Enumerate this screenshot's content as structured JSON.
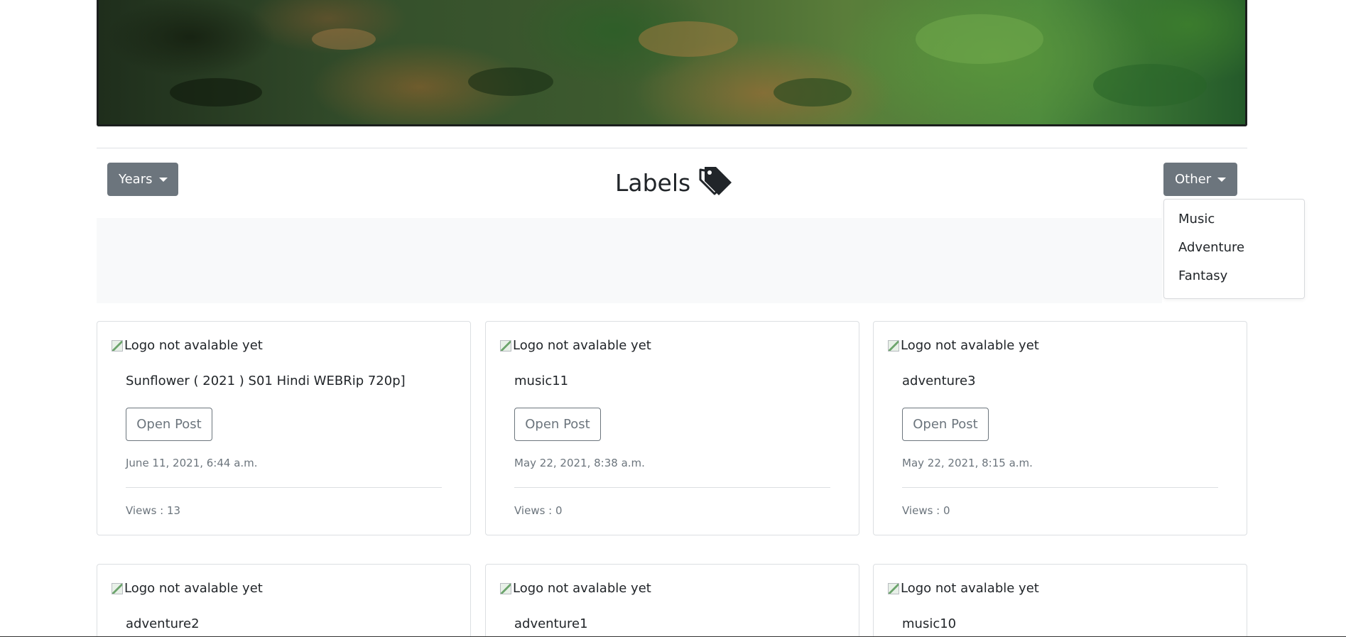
{
  "hero": {
    "image": "forest-banner"
  },
  "filters": {
    "years_label": "Years",
    "other_label": "Other",
    "other_menu": [
      "Music",
      "Adventure",
      "Fantasy"
    ]
  },
  "heading": {
    "title": "Labels",
    "icon": "tags-icon"
  },
  "posts": [
    {
      "image_alt": "Logo not avalable yet",
      "title": "Sunflower ( 2021 ) S01 Hindi WEBRip 720p]",
      "button": "Open Post",
      "date": "June 11, 2021, 6:44 a.m.",
      "views": "Views : 13"
    },
    {
      "image_alt": "Logo not avalable yet",
      "title": "music11",
      "button": "Open Post",
      "date": "May 22, 2021, 8:38 a.m.",
      "views": "Views : 0"
    },
    {
      "image_alt": "Logo not avalable yet",
      "title": "adventure3",
      "button": "Open Post",
      "date": "May 22, 2021, 8:15 a.m.",
      "views": "Views : 0"
    },
    {
      "image_alt": "Logo not avalable yet",
      "title": "adventure2"
    },
    {
      "image_alt": "Logo not avalable yet",
      "title": "adventure1"
    },
    {
      "image_alt": "Logo not avalable yet",
      "title": "music10"
    }
  ]
}
